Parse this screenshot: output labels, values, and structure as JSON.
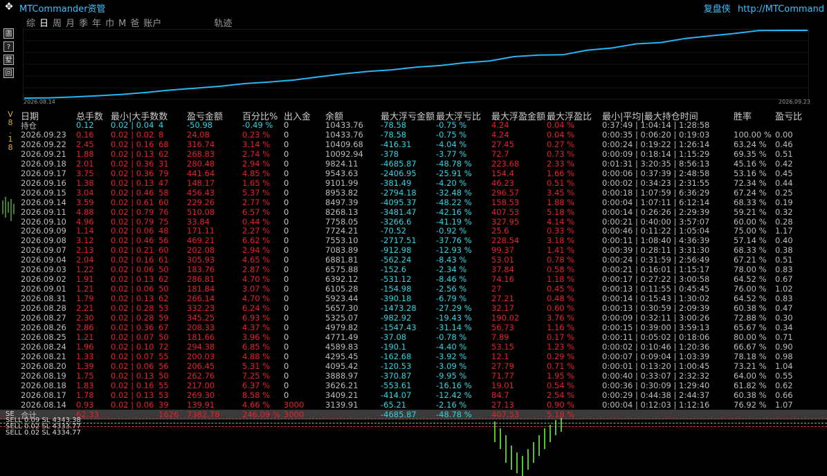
{
  "header": {
    "app_title": "MTCommander资管",
    "right_label": "复盘侠",
    "right_url": "http://MTCommand",
    "version": "V8.18"
  },
  "side_buttons": [
    {
      "icon": "report-icon",
      "glyph": "圕"
    },
    {
      "icon": "help-icon",
      "glyph": "?"
    },
    {
      "icon": "list-icon",
      "glyph": "墅"
    },
    {
      "icon": "window-icon",
      "glyph": "回"
    }
  ],
  "tabs": [
    {
      "label": "综",
      "active": false
    },
    {
      "label": "日",
      "active": true
    },
    {
      "label": "周",
      "active": false
    },
    {
      "label": "月",
      "active": false
    },
    {
      "label": "季",
      "active": false
    },
    {
      "label": "年",
      "active": false
    },
    {
      "label": "巾",
      "active": false
    },
    {
      "label": "M",
      "active": false
    },
    {
      "label": "爸",
      "active": false
    },
    {
      "label": "账户",
      "active": false
    },
    {
      "label": "轨迹",
      "active": false
    }
  ],
  "chart_data": {
    "type": "line",
    "x_start_label": "2026.08.14",
    "x_end_label": "2026.09.23",
    "values": [
      3000,
      3030,
      3120,
      3260,
      3409,
      3626,
      3889,
      4095,
      4295,
      4590,
      4771,
      4980,
      5325,
      5657,
      5923,
      6105,
      6392,
      6576,
      6882,
      7084,
      7553,
      7724,
      7758,
      8268,
      8497,
      8954,
      9102,
      9544,
      9824,
      10093,
      10410,
      10434,
      10434
    ],
    "color": "#29b6f6"
  },
  "table": {
    "headers": [
      "日期",
      "总手数",
      "最小|大手数数",
      "盈亏金额",
      "百分比%",
      "出入金",
      "余额",
      "最大浮亏金额",
      "最大浮亏比",
      "最大浮盈金额",
      "最大浮盈比",
      "最小|平均|最大持仓时间",
      "胜率",
      "盈亏比"
    ],
    "position_row": {
      "date": "持仓",
      "total": "0.12",
      "minmax": "0.02 | 0.04",
      "count": "4",
      "pl": "-50.98",
      "pct": "-0.49 %",
      "io": "0",
      "balance": "10433.76",
      "float_loss": "-78.58",
      "float_loss_pct": "-0.75 %",
      "float_profit": "4.24",
      "float_profit_pct": "0.04 %",
      "time": "0:37:49 | 1:04:14 | 1:28:58",
      "win": "",
      "ratio": ""
    },
    "rows": [
      {
        "date": "2026.09.23",
        "total": "0.16",
        "minmax": "0.02 | 0.02",
        "count": "8",
        "pl": "24.08",
        "pct": "0.23 %",
        "io": "0",
        "balance": "10433.76",
        "float_loss": "-78.58",
        "float_loss_pct": "-0.75 %",
        "float_profit": "4.24",
        "float_profit_pct": "0.04 %",
        "time": "0:00:35 | 0:06:20 | 0:19:03",
        "win": "100.00 %",
        "ratio": "0.00"
      },
      {
        "date": "2026.09.22",
        "total": "2.45",
        "minmax": "0.02 | 0.16",
        "count": "68",
        "pl": "316.74",
        "pct": "3.14 %",
        "io": "0",
        "balance": "10409.68",
        "float_loss": "-416.31",
        "float_loss_pct": "-4.04 %",
        "float_profit": "27.45",
        "float_profit_pct": "0.27 %",
        "time": "0:00:24 | 0:19:22 | 1:26:14",
        "win": "63.24 %",
        "ratio": "0.46"
      },
      {
        "date": "2026.09.21",
        "total": "1.88",
        "minmax": "0.02 | 0.13",
        "count": "62",
        "pl": "268.83",
        "pct": "2.74 %",
        "io": "0",
        "balance": "10092.94",
        "float_loss": "-378",
        "float_loss_pct": "-3.77 %",
        "float_profit": "72.7",
        "float_profit_pct": "0.73 %",
        "time": "0:00:09 | 0:18:14 | 1:15:29",
        "win": "69.35 %",
        "ratio": "0.51"
      },
      {
        "date": "2026.09.18",
        "total": "2.01",
        "minmax": "0.02 | 0.36",
        "count": "31",
        "pl": "280.48",
        "pct": "2.94 %",
        "io": "0",
        "balance": "9824.11",
        "float_loss": "-4685.87",
        "float_loss_pct": "-48.78 %",
        "float_profit": "223.68",
        "float_profit_pct": "2.33 %",
        "time": "0:01:31 | 3:20:35 | 8:56:13",
        "win": "45.16 %",
        "ratio": "0.42"
      },
      {
        "date": "2026.09.17",
        "total": "3.75",
        "minmax": "0.02 | 0.36",
        "count": "79",
        "pl": "441.64",
        "pct": "4.85 %",
        "io": "0",
        "balance": "9543.63",
        "float_loss": "-2406.95",
        "float_loss_pct": "-25.91 %",
        "float_profit": "154.4",
        "float_profit_pct": "1.66 %",
        "time": "0:00:06 | 0:37:39 | 2:48:58",
        "win": "53.16 %",
        "ratio": "0.45"
      },
      {
        "date": "2026.09.16",
        "total": "1.38",
        "minmax": "0.02 | 0.13",
        "count": "47",
        "pl": "148.17",
        "pct": "1.65 %",
        "io": "0",
        "balance": "9101.99",
        "float_loss": "-381.49",
        "float_loss_pct": "-4.20 %",
        "float_profit": "46.23",
        "float_profit_pct": "0.51 %",
        "time": "0:00:02 | 0:34:23 | 2:31:55",
        "win": "72.34 %",
        "ratio": "0.44"
      },
      {
        "date": "2026.09.15",
        "total": "3.04",
        "minmax": "0.02 | 0.46",
        "count": "58",
        "pl": "456.43",
        "pct": "5.37 %",
        "io": "0",
        "balance": "8953.82",
        "float_loss": "-2794.18",
        "float_loss_pct": "-32.48 %",
        "float_profit": "296.57",
        "float_profit_pct": "3.45 %",
        "time": "0:00:18 | 1:07:59 | 6:36:29",
        "win": "67.24 %",
        "ratio": "0.25"
      },
      {
        "date": "2026.09.14",
        "total": "3.59",
        "minmax": "0.02 | 0.61",
        "count": "60",
        "pl": "229.26",
        "pct": "2.77 %",
        "io": "0",
        "balance": "8497.39",
        "float_loss": "-4095.37",
        "float_loss_pct": "-48.22 %",
        "float_profit": "158.53",
        "float_profit_pct": "1.88 %",
        "time": "0:00:04 | 1:07:11 | 6:12:14",
        "win": "68.33 %",
        "ratio": "0.19"
      },
      {
        "date": "2026.09.11",
        "total": "4.88",
        "minmax": "0.02 | 0.79",
        "count": "76",
        "pl": "510.08",
        "pct": "6.57 %",
        "io": "0",
        "balance": "8268.13",
        "float_loss": "-3481.47",
        "float_loss_pct": "-42.16 %",
        "float_profit": "407.53",
        "float_profit_pct": "5.18 %",
        "time": "0:00:14 | 0:26:26 | 2:29:39",
        "win": "59.21 %",
        "ratio": "0.32"
      },
      {
        "date": "2026.09.10",
        "total": "4.96",
        "minmax": "0.02 | 0.79",
        "count": "75",
        "pl": "33.84",
        "pct": "0.44 %",
        "io": "0",
        "balance": "7758.05",
        "float_loss": "-3266.6",
        "float_loss_pct": "-41.19 %",
        "float_profit": "327.95",
        "float_profit_pct": "4.14 %",
        "time": "0:00:21 | 0:40:00 | 3:57:07",
        "win": "60.00 %",
        "ratio": "0.28"
      },
      {
        "date": "2026.09.09",
        "total": "1.14",
        "minmax": "0.02 | 0.06",
        "count": "48",
        "pl": "171.11",
        "pct": "2.27 %",
        "io": "0",
        "balance": "7724.21",
        "float_loss": "-70.52",
        "float_loss_pct": "-0.92 %",
        "float_profit": "25.6",
        "float_profit_pct": "0.33 %",
        "time": "0:00:46 | 0:11:22 | 1:05:04",
        "win": "75.00 %",
        "ratio": "1.17"
      },
      {
        "date": "2026.09.08",
        "total": "3.12",
        "minmax": "0.02 | 0.46",
        "count": "56",
        "pl": "469.21",
        "pct": "6.62 %",
        "io": "0",
        "balance": "7553.10",
        "float_loss": "-2717.51",
        "float_loss_pct": "-37.76 %",
        "float_profit": "228.54",
        "float_profit_pct": "3.18 %",
        "time": "0:00:11 | 1:08:40 | 4:36:39",
        "win": "57.14 %",
        "ratio": "0.40"
      },
      {
        "date": "2026.09.07",
        "total": "2.13",
        "minmax": "0.02 | 0.21",
        "count": "60",
        "pl": "202.08",
        "pct": "2.94 %",
        "io": "0",
        "balance": "7083.89",
        "float_loss": "-912.98",
        "float_loss_pct": "-12.93 %",
        "float_profit": "99.37",
        "float_profit_pct": "1.41 %",
        "time": "0:00:39 | 0:28:11 | 3:31:30",
        "win": "68.33 %",
        "ratio": "0.38"
      },
      {
        "date": "2026.09.04",
        "total": "2.04",
        "minmax": "0.02 | 0.16",
        "count": "61",
        "pl": "305.93",
        "pct": "4.65 %",
        "io": "0",
        "balance": "6881.81",
        "float_loss": "-562.24",
        "float_loss_pct": "-8.43 %",
        "float_profit": "53.01",
        "float_profit_pct": "0.78 %",
        "time": "0:00:24 | 0:31:59 | 2:56:49",
        "win": "67.21 %",
        "ratio": "0.51"
      },
      {
        "date": "2026.09.03",
        "total": "1.22",
        "minmax": "0.02 | 0.06",
        "count": "50",
        "pl": "183.76",
        "pct": "2.87 %",
        "io": "0",
        "balance": "6575.88",
        "float_loss": "-152.6",
        "float_loss_pct": "-2.34 %",
        "float_profit": "37.84",
        "float_profit_pct": "0.58 %",
        "time": "0:00:21 | 0:16:01 | 1:15:17",
        "win": "78.00 %",
        "ratio": "0.83"
      },
      {
        "date": "2026.09.02",
        "total": "1.91",
        "minmax": "0.02 | 0.13",
        "count": "62",
        "pl": "286.81",
        "pct": "4.70 %",
        "io": "0",
        "balance": "6392.12",
        "float_loss": "-531.12",
        "float_loss_pct": "-8.46 %",
        "float_profit": "74.16",
        "float_profit_pct": "1.18 %",
        "time": "0:00:17 | 0:27:22 | 3:00:58",
        "win": "64.52 %",
        "ratio": "0.67"
      },
      {
        "date": "2026.09.01",
        "total": "1.21",
        "minmax": "0.02 | 0.06",
        "count": "50",
        "pl": "181.84",
        "pct": "3.07 %",
        "io": "0",
        "balance": "6105.28",
        "float_loss": "-154.98",
        "float_loss_pct": "-2.56 %",
        "float_profit": "27",
        "float_profit_pct": "0.45 %",
        "time": "0:00:13 | 0:11:55 | 0:45:45",
        "win": "76.00 %",
        "ratio": "1.02"
      },
      {
        "date": "2026.08.31",
        "total": "1.79",
        "minmax": "0.02 | 0.13",
        "count": "62",
        "pl": "266.14",
        "pct": "4.70 %",
        "io": "0",
        "balance": "5923.44",
        "float_loss": "-390.18",
        "float_loss_pct": "-6.79 %",
        "float_profit": "27.21",
        "float_profit_pct": "0.48 %",
        "time": "0:00:14 | 0:15:43 | 1:30:02",
        "win": "64.52 %",
        "ratio": "0.83"
      },
      {
        "date": "2026.08.28",
        "total": "2.21",
        "minmax": "0.02 | 0.28",
        "count": "53",
        "pl": "332.23",
        "pct": "6.24 %",
        "io": "0",
        "balance": "5657.30",
        "float_loss": "-1473.28",
        "float_loss_pct": "-27.29 %",
        "float_profit": "32.17",
        "float_profit_pct": "0.60 %",
        "time": "0:00:13 | 0:30:59 | 2:09:39",
        "win": "60.38 %",
        "ratio": "0.47"
      },
      {
        "date": "2026.08.27",
        "total": "2.30",
        "minmax": "0.02 | 0.28",
        "count": "59",
        "pl": "345.25",
        "pct": "6.93 %",
        "io": "0",
        "balance": "5325.07",
        "float_loss": "-982.92",
        "float_loss_pct": "-19.43 %",
        "float_profit": "190.02",
        "float_profit_pct": "3.76 %",
        "time": "0:00:09 | 0:32:11 | 3:00:26",
        "win": "72.88 %",
        "ratio": "0.30"
      },
      {
        "date": "2026.08.26",
        "total": "2.86",
        "minmax": "0.02 | 0.36",
        "count": "67",
        "pl": "208.33",
        "pct": "4.37 %",
        "io": "0",
        "balance": "4979.82",
        "float_loss": "-1547.43",
        "float_loss_pct": "-31.14 %",
        "float_profit": "56.73",
        "float_profit_pct": "1.16 %",
        "time": "0:00:15 | 0:39:00 | 3:59:13",
        "win": "65.67 %",
        "ratio": "0.34"
      },
      {
        "date": "2026.08.25",
        "total": "1.21",
        "minmax": "0.02 | 0.07",
        "count": "50",
        "pl": "181.66",
        "pct": "3.96 %",
        "io": "0",
        "balance": "4771.49",
        "float_loss": "-37.08",
        "float_loss_pct": "-0.78 %",
        "float_profit": "7.89",
        "float_profit_pct": "0.17 %",
        "time": "0:00:11 | 0:05:02 | 0:18:06",
        "win": "80.00 %",
        "ratio": "0.71"
      },
      {
        "date": "2026.08.24",
        "total": "1.96",
        "minmax": "0.02 | 0.10",
        "count": "72",
        "pl": "294.38",
        "pct": "6.85 %",
        "io": "0",
        "balance": "4589.83",
        "float_loss": "-190.1",
        "float_loss_pct": "-4.40 %",
        "float_profit": "53.15",
        "float_profit_pct": "1.23 %",
        "time": "0:00:02 | 0:10:46 | 1:20:36",
        "win": "66.67 %",
        "ratio": "0.90"
      },
      {
        "date": "2026.08.21",
        "total": "1.33",
        "minmax": "0.02 | 0.07",
        "count": "55",
        "pl": "200.03",
        "pct": "4.88 %",
        "io": "0",
        "balance": "4295.45",
        "float_loss": "-162.68",
        "float_loss_pct": "-3.92 %",
        "float_profit": "12.1",
        "float_profit_pct": "0.29 %",
        "time": "0:00:07 | 0:09:04 | 1:03:39",
        "win": "78.18 %",
        "ratio": "0.98"
      },
      {
        "date": "2026.08.20",
        "total": "1.39",
        "minmax": "0.02 | 0.06",
        "count": "56",
        "pl": "206.45",
        "pct": "5.31 %",
        "io": "0",
        "balance": "4095.42",
        "float_loss": "-120.53",
        "float_loss_pct": "-3.09 %",
        "float_profit": "27.79",
        "float_profit_pct": "0.71 %",
        "time": "0:00:01 | 0:13:20 | 1:00:45",
        "win": "73.21 %",
        "ratio": "1.04"
      },
      {
        "date": "2026.08.19",
        "total": "1.75",
        "minmax": "0.02 | 0.13",
        "count": "50",
        "pl": "262.76",
        "pct": "7.25 %",
        "io": "0",
        "balance": "3888.97",
        "float_loss": "-370.87",
        "float_loss_pct": "-9.95 %",
        "float_profit": "71.77",
        "float_profit_pct": "1.95 %",
        "time": "0:00:40 | 0:33:07 | 2:32:32",
        "win": "64.00 %",
        "ratio": "0.55"
      },
      {
        "date": "2026.08.18",
        "total": "1.83",
        "minmax": "0.02 | 0.16",
        "count": "55",
        "pl": "217.00",
        "pct": "6.37 %",
        "io": "0",
        "balance": "3626.21",
        "float_loss": "-553.61",
        "float_loss_pct": "-16.16 %",
        "float_profit": "19.01",
        "float_profit_pct": "0.54 %",
        "time": "0:00:36 | 0:30:09 | 1:29:40",
        "win": "61.82 %",
        "ratio": "0.62"
      },
      {
        "date": "2026.08.17",
        "total": "1.78",
        "minmax": "0.02 | 0.13",
        "count": "53",
        "pl": "269.30",
        "pct": "8.58 %",
        "io": "0",
        "balance": "3409.21",
        "float_loss": "-414.07",
        "float_loss_pct": "-12.42 %",
        "float_profit": "84.7",
        "float_profit_pct": "2.54 %",
        "time": "0:00:29 | 0:44:38 | 2:44:37",
        "win": "60.38 %",
        "ratio": "0.66"
      },
      {
        "date": "2026.08.14",
        "total": "0.93",
        "minmax": "0.02 | 0.06",
        "count": "39",
        "pl": "139.91",
        "pct": "4.66 %",
        "io": "3000",
        "balance": "3139.91",
        "float_loss": "-65.21",
        "float_loss_pct": "-2.16 %",
        "float_profit": "27.13",
        "float_profit_pct": "0.90 %",
        "time": "0:00:04 | 0:12:03 | 1:12:16",
        "win": "76.92 %",
        "ratio": "1.07"
      }
    ],
    "summary_row": {
      "date": "合计",
      "total": "62.33",
      "minmax": "",
      "count": "1626",
      "pl": "7382.78",
      "pct": "246.09 %",
      "io": "3000",
      "balance": "",
      "float_loss": "-4685.87",
      "float_loss_pct": "-48.78 %",
      "float_profit": "407.53",
      "float_profit_pct": "5.18 %",
      "time": "",
      "win": "",
      "ratio": ""
    }
  },
  "order_lines": [
    "SELL 0.09 SL 4343.38",
    "SELL 0.02 SL 4333.77",
    "SELL 0.02 SL 4334.77"
  ],
  "chart_marker": "SE"
}
